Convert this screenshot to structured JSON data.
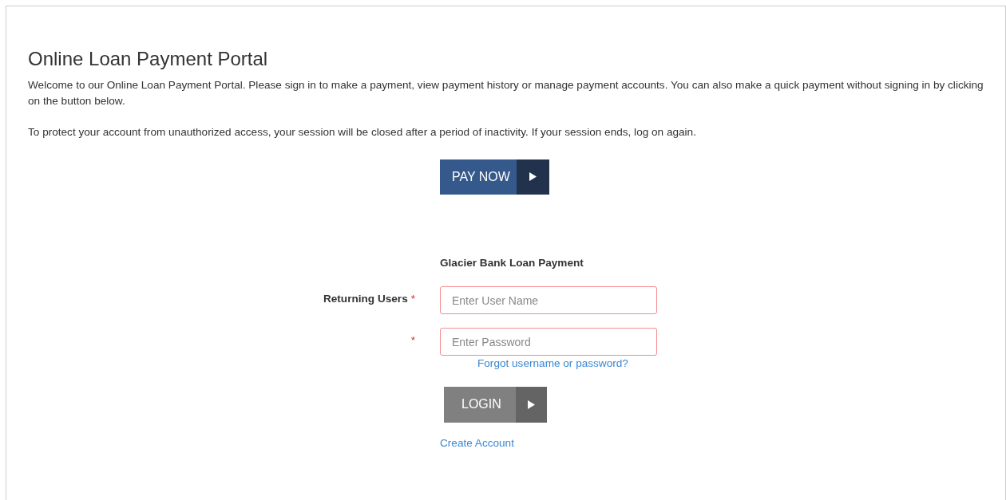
{
  "title": "Online Loan Payment Portal",
  "paragraphs": [
    "Welcome to our Online Loan Payment Portal. Please sign in to make a payment, view payment history or manage payment accounts. You can also make a quick payment without signing in by clicking on the button below.",
    "To protect your account from unauthorized access, your session will be closed after a period of inactivity. If your session ends, log on again."
  ],
  "pay_button": {
    "label": "PAY NOW"
  },
  "form": {
    "heading": "Glacier Bank Loan Payment",
    "fields": [
      {
        "label": "Returning Users",
        "required_mark": "*",
        "placeholder": "Enter User Name",
        "invalid": true
      },
      {
        "required_mark": "*",
        "placeholder": "Enter Password",
        "invalid": true
      }
    ],
    "forgot_link": "Forgot username or password?",
    "login_button": {
      "label": "LOGIN"
    },
    "create_link": "Create Account"
  }
}
